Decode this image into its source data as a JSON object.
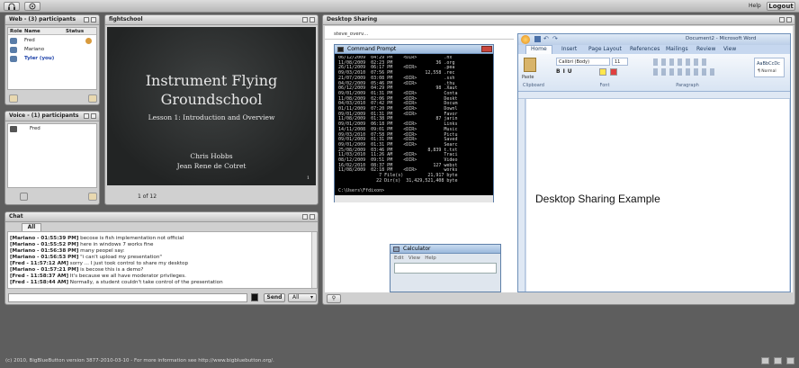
{
  "topbar": {
    "help": "Help",
    "logout": "Logout"
  },
  "users": {
    "title": "Web - (3) participants",
    "columns": [
      "Role",
      "Name",
      "Status"
    ],
    "rows": [
      {
        "name": "Fred"
      },
      {
        "name": "Mariano"
      },
      {
        "name": "Tyler (you)"
      }
    ]
  },
  "voice": {
    "title": "Voice - (1) participants",
    "participants": [
      "Fred"
    ]
  },
  "presentation": {
    "title": "fightschool",
    "slide": {
      "heading1": "Instrument Flying",
      "heading2": "Groundschool",
      "subtitle": "Lesson 1: Introduction and Overview",
      "author1": "Chris Hobbs",
      "author2": "Jean Rene de Cotret",
      "page_no": "1"
    },
    "page_indicator": "1 of 12"
  },
  "chat": {
    "title": "Chat",
    "tab": "All",
    "messages": [
      {
        "who": "[Mariano - 01:55:39 PM]",
        "text": " becose is fish implementation not official"
      },
      {
        "who": "[Mariano - 01:55:52 PM]",
        "text": " here in windows 7 works fine"
      },
      {
        "who": "[Mariano - 01:56:38 PM]",
        "text": " many peopel say:"
      },
      {
        "who": "[Mariano - 01:56:53 PM]",
        "text": " \"i can't upload my presentation\""
      },
      {
        "who": "[Fred - 11:57:12 AM]",
        "text": " sorry ... I just took control to share my desktop"
      },
      {
        "who": "[Mariano - 01:57:21 PM]",
        "text": " is becose this is a demo?"
      },
      {
        "who": "[Fred - 11:58:37 AM]",
        "text": " It's because we all have moderator privileges."
      },
      {
        "who": "[Fred - 11:58:44 AM]",
        "text": " Normally, a student couldn't take control of the presentation"
      }
    ],
    "send": "Send",
    "target": "All"
  },
  "desktop": {
    "title": "Desktop Sharing",
    "path": "steve_overv...",
    "cmd": {
      "title": "Command Prompt",
      "lines": [
        "06/12/2009  04:29 PM    <DIR>          .nx",
        "11/08/2009  02:23 PM                36 .org",
        "26/11/2009  06:17 PM    <DIR>          .pea",
        "09/03/2010  07:56 PM            12,558 .rec",
        "21/07/2009  03:08 PM    <DIR>          .ssh",
        "04/02/2009  05:46 PM    <DIR>          .thu",
        "06/12/2009  04:29 PM                98 .Xaut",
        "09/01/2009  01:31 PM    <DIR>          Conta",
        "11/08/2009  02:06 PM    <DIR>          Deskt",
        "04/03/2010  07:42 PM    <DIR>          Docum",
        "01/11/2009  07:20 PM    <DIR>          Downl",
        "09/01/2009  01:31 PM    <DIR>          Favor",
        "11/08/2009  01:38 PM                87 jarin",
        "09/01/2009  06:18 PM    <DIR>          Links",
        "14/11/2008  09:01 PM    <DIR>          Music",
        "09/03/2010  07:58 PM    <DIR>          Pictu",
        "09/01/2009  01:31 PM    <DIR>          Saved",
        "09/01/2009  01:31 PM    <DIR>          Searc",
        "25/08/2009  03:46 PM             8,839 t.txt",
        "11/03/2010  11:26 AM    <DIR>          Traci",
        "08/12/2009  09:51 PM    <DIR>          Video",
        "16/02/2010  08:37 PM               127 webst",
        "11/08/2009  02:18 PM    <DIR>          works",
        "               7 File(s)         21,917 byte",
        "              22 Dir(s)  31,429,521,408 byte",
        "",
        "C:\\Users\\Ffdixon>"
      ]
    },
    "calc": {
      "title": "Calculator",
      "menu": [
        "Edit",
        "View",
        "Help"
      ]
    },
    "word": {
      "title": "Document2 - Microsoft Word",
      "tabs": [
        "Home",
        "Insert",
        "Page Layout",
        "References",
        "Mailings",
        "Review",
        "View"
      ],
      "font": "Calibri (Body)",
      "size": "11",
      "paste": "Paste",
      "groups": [
        "Clipboard",
        "Font",
        "Paragraph"
      ],
      "style_preview": "AaBbCcDc",
      "style_name": "¶ Normal",
      "body_text": "Desktop Sharing Example"
    }
  },
  "footer": "(c) 2010, BigBlueButton version 3877-2010-03-10 - For more information see http://www.bigbluebutton.org/."
}
